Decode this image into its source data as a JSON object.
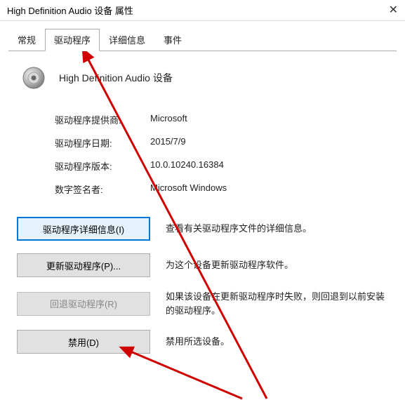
{
  "window": {
    "title": "High Definition Audio 设备 属性",
    "close": "✕"
  },
  "tabs": {
    "general": "常规",
    "driver": "驱动程序",
    "details": "详细信息",
    "events": "事件"
  },
  "device": {
    "name": "High Definition Audio 设备"
  },
  "info": {
    "provider_label": "驱动程序提供商:",
    "provider_value": "Microsoft",
    "date_label": "驱动程序日期:",
    "date_value": "2015/7/9",
    "version_label": "驱动程序版本:",
    "version_value": "10.0.10240.16384",
    "signer_label": "数字签名者:",
    "signer_value": "Microsoft Windows"
  },
  "actions": {
    "details_btn": "驱动程序详细信息(I)",
    "details_desc": "查看有关驱动程序文件的详细信息。",
    "update_btn": "更新驱动程序(P)...",
    "update_desc": "为这个设备更新驱动程序软件。",
    "rollback_btn": "回退驱动程序(R)",
    "rollback_desc": "如果该设备在更新驱动程序时失败，则回退到以前安装的驱动程序。",
    "disable_btn": "禁用(D)",
    "disable_desc": "禁用所选设备。"
  }
}
